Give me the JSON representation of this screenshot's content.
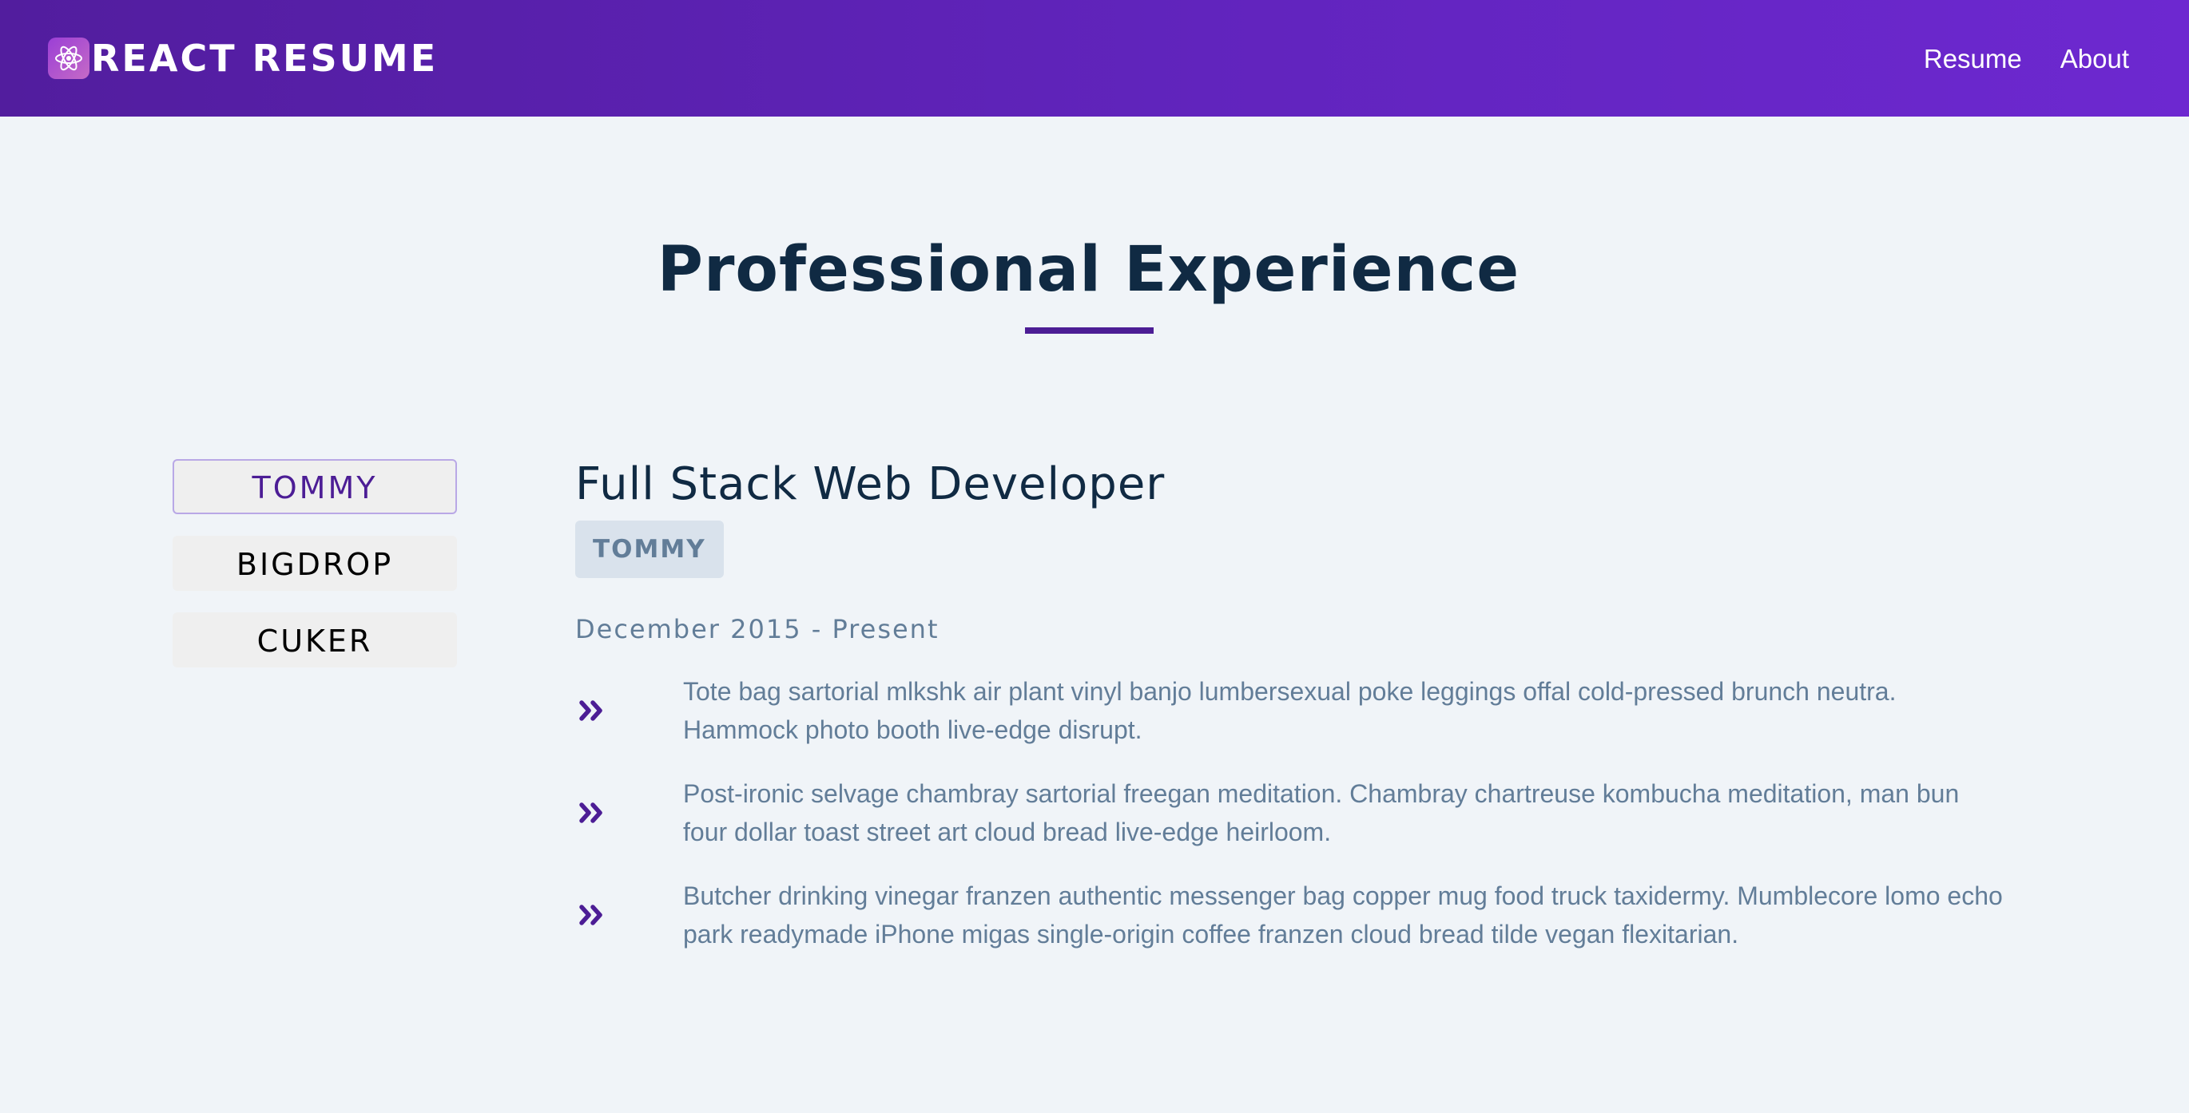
{
  "brand": {
    "name": "REACT RESUME",
    "logo_icon": "react-atom-icon"
  },
  "nav": {
    "items": [
      {
        "label": "Resume"
      },
      {
        "label": "About"
      }
    ]
  },
  "section": {
    "title": "Professional Experience",
    "accent_color": "#4c1d95"
  },
  "companies": {
    "tabs": [
      {
        "label": "TOMMY",
        "active": true
      },
      {
        "label": "BIGDROP",
        "active": false
      },
      {
        "label": "CUKER",
        "active": false
      }
    ]
  },
  "job": {
    "title": "Full Stack Web Developer",
    "company": "TOMMY",
    "dates": "December 2015 - Present",
    "bullet_icon": "double-chevron-right-icon",
    "duties": [
      "Tote bag sartorial mlkshk air plant vinyl banjo lumbersexual poke leggings offal cold-pressed brunch neutra. Hammock photo booth live-edge disrupt.",
      "Post-ironic selvage chambray sartorial freegan meditation. Chambray chartreuse kombucha meditation, man bun four dollar toast street art cloud bread live-edge heirloom.",
      "Butcher drinking vinegar franzen authentic messenger bag copper mug food truck taxidermy. Mumblecore lomo echo park readymade iPhone migas single-origin coffee franzen cloud bread tilde vegan flexitarian."
    ]
  },
  "colors": {
    "header_gradient_start": "#521d9e",
    "header_gradient_end": "#6d28d0",
    "background": "#f0f4f8",
    "heading": "#102a43",
    "muted_text": "#627d98"
  }
}
